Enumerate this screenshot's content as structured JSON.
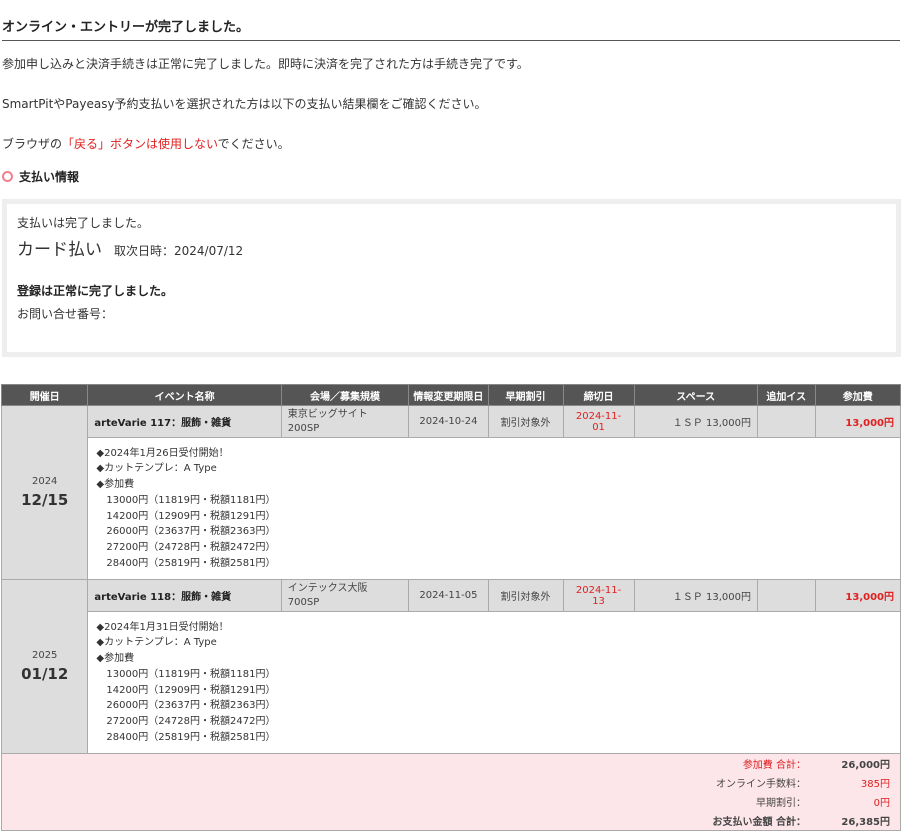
{
  "title": "オンライン・エントリーが完了しました。",
  "messages": {
    "m1": "参加申し込みと決済手続きは正常に完了しました。即時に決済を完了された方は手続き完了です。",
    "m2": "SmartPitやPayeasy予約支払いを選択された方は以下の支払い結果欄をご確認ください。",
    "m3_pre": "ブラウザの",
    "m3_red": "「戻る」ボタンは使用しない",
    "m3_post": "でください。"
  },
  "payment": {
    "section_title": "支払い情報",
    "status": "支払いは完了しました。",
    "method": "カード払い",
    "transaction_date": "取次日時：2024/07/12",
    "registered": "登録は正常に完了しました。",
    "inquiry_label": "お問い合せ番号："
  },
  "table": {
    "headers": [
      "開催日",
      "イベント名称",
      "会場／募集規模",
      "情報変更期限日",
      "早期割引",
      "締切日",
      "スペース",
      "追加イス",
      "参加費"
    ],
    "events": [
      {
        "year": "2024",
        "monthday": "12/15",
        "name": "arteVarie 117：服飾・雑貨",
        "venue": "東京ビッグサイト",
        "scale": "200SP",
        "change_deadline": "2024-10-24",
        "early_discount": "割引対象外",
        "deadline": "2024-11-01",
        "space": "１ＳＰ 13,000円",
        "extra_chair": "",
        "fee": "13,000円",
        "details": [
          "◆2024年1月26日受付開始！",
          "◆カットテンプレ：A Type",
          "◆参加費"
        ],
        "fee_lines": [
          "13000円（11819円・税額1181円）",
          "14200円（12909円・税額1291円）",
          "26000円（23637円・税額2363円）",
          "27200円（24728円・税額2472円）",
          "28400円（25819円・税額2581円）"
        ]
      },
      {
        "year": "2025",
        "monthday": "01/12",
        "name": "arteVarie 118：服飾・雑貨",
        "venue": "インテックス大阪",
        "scale": "700SP",
        "change_deadline": "2024-11-05",
        "early_discount": "割引対象外",
        "deadline": "2024-11-13",
        "space": "１ＳＰ 13,000円",
        "extra_chair": "",
        "fee": "13,000円",
        "details": [
          "◆2024年1月31日受付開始！",
          "◆カットテンプレ：A Type",
          "◆参加費"
        ],
        "fee_lines": [
          "13000円（11819円・税額1181円）",
          "14200円（12909円・税額1291円）",
          "26000円（23637円・税額2363円）",
          "27200円（24728円・税額2472円）",
          "28400円（25819円・税額2581円）"
        ]
      }
    ],
    "summary": {
      "fee_total_label": "参加費 合計：",
      "fee_total": "26,000円",
      "online_fee_label": "オンライン手数料：",
      "online_fee": "385円",
      "early_discount_label": "早期割引：",
      "early_discount": "0円",
      "grand_total_label": "お支払い金額 合計：",
      "grand_total": "26,385円"
    }
  },
  "colors": {
    "accent_red": "#e02020",
    "header_bg": "#555555",
    "summary_bg": "#fde6ea",
    "circle_icon": "#f08090"
  }
}
